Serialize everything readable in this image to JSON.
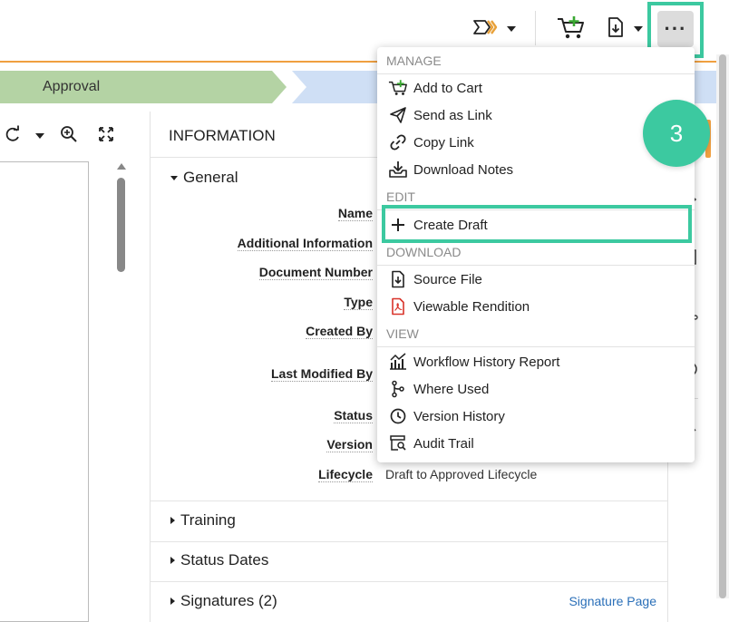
{
  "toolbar": {
    "workflow_icon": "workflow-arrows-icon",
    "cart_icon": "add-to-cart-icon",
    "download_icon": "document-download-icon",
    "more_label": "···"
  },
  "lifecycle": {
    "current_stage": "Approval"
  },
  "info_panel": {
    "title": "INFORMATION",
    "general_label": "General",
    "fields": [
      {
        "label": "Name",
        "value": ""
      },
      {
        "label": "Additional Information",
        "value": ""
      },
      {
        "label": "Document Number",
        "value": ""
      },
      {
        "label": "Type",
        "value": ""
      },
      {
        "label": "Created By",
        "value": ""
      },
      {
        "label": "Last Modified By",
        "value": ""
      },
      {
        "label": "Status",
        "value": ""
      },
      {
        "label": "Version",
        "value": ""
      },
      {
        "label": "Lifecycle",
        "value": "Draft to Approved Lifecycle"
      }
    ],
    "sections": [
      {
        "label": "Training"
      },
      {
        "label": "Status Dates"
      },
      {
        "label": "Signatures (2)"
      }
    ],
    "signature_link": "Signature Page"
  },
  "menu": {
    "groups": [
      {
        "header": "MANAGE",
        "items": [
          {
            "label": "Add to Cart",
            "icon": "add-to-cart-icon"
          },
          {
            "label": "Send as Link",
            "icon": "send-icon"
          },
          {
            "label": "Copy Link",
            "icon": "link-icon"
          },
          {
            "label": "Download Notes",
            "icon": "download-tray-icon"
          }
        ]
      },
      {
        "header": "EDIT",
        "items": [
          {
            "label": "Create Draft",
            "icon": "plus-icon"
          }
        ]
      },
      {
        "header": "DOWNLOAD",
        "items": [
          {
            "label": "Source File",
            "icon": "file-download-icon"
          },
          {
            "label": "Viewable Rendition",
            "icon": "pdf-icon"
          }
        ]
      },
      {
        "header": "VIEW",
        "items": [
          {
            "label": "Workflow History Report",
            "icon": "chart-icon"
          },
          {
            "label": "Where Used",
            "icon": "branch-icon"
          },
          {
            "label": "Version History",
            "icon": "clock-icon"
          },
          {
            "label": "Audit Trail",
            "icon": "audit-icon"
          }
        ]
      }
    ]
  },
  "callout": {
    "number": "3",
    "color": "#3cc9a0"
  }
}
